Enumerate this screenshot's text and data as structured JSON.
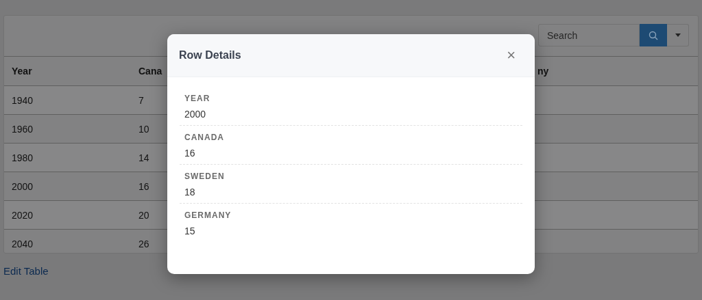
{
  "table": {
    "search": {
      "placeholder": "Search"
    },
    "columns": [
      "Year",
      "Cana",
      "ny"
    ],
    "rows": [
      [
        "1940",
        "7",
        ""
      ],
      [
        "1960",
        "10",
        ""
      ],
      [
        "1980",
        "14",
        ""
      ],
      [
        "2000",
        "16",
        ""
      ],
      [
        "2020",
        "20",
        ""
      ],
      [
        "2040",
        "26",
        ""
      ]
    ]
  },
  "edit_link": "Edit Table",
  "dialog": {
    "title": "Row Details",
    "close": "×",
    "fields": [
      {
        "label": "YEAR",
        "value": "2000"
      },
      {
        "label": "CANADA",
        "value": "16"
      },
      {
        "label": "SWEDEN",
        "value": "18"
      },
      {
        "label": "GERMANY",
        "value": "15"
      }
    ]
  }
}
